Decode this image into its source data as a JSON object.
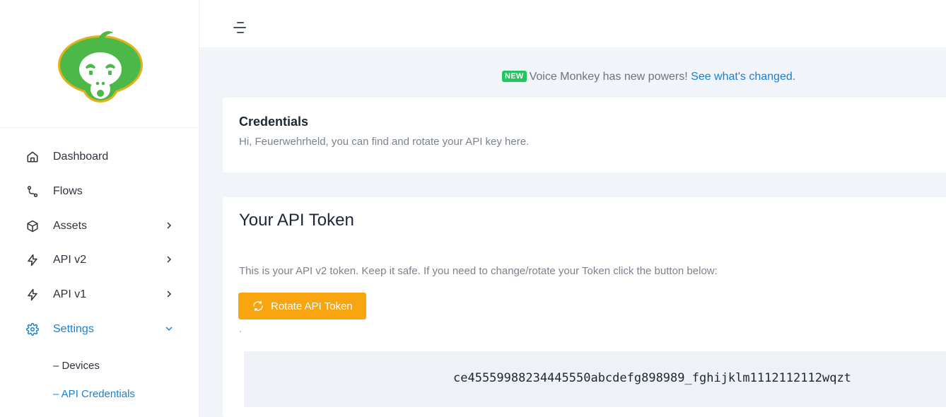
{
  "sidebar": {
    "items": [
      {
        "label": "Dashboard",
        "icon": "home-icon"
      },
      {
        "label": "Flows",
        "icon": "route-icon"
      },
      {
        "label": "Assets",
        "icon": "box-icon"
      },
      {
        "label": "API v2",
        "icon": "bolt-icon"
      },
      {
        "label": "API v1",
        "icon": "bolt-icon"
      },
      {
        "label": "Settings",
        "icon": "gear-icon"
      }
    ],
    "sub_items": [
      {
        "label": "– Devices"
      },
      {
        "label": "– API Credentials"
      }
    ]
  },
  "notice": {
    "badge": "NEW",
    "text": "Voice Monkey has new powers! ",
    "link": "See what's changed",
    "suffix": "."
  },
  "credentials": {
    "title": "Credentials",
    "subtitle": "Hi, Feuerwehrheld, you can find and rotate your API key here."
  },
  "token_card": {
    "title": "Your API Token",
    "description": "This is your API v2 token. Keep it safe. If you need to change/rotate your Token click the button below:",
    "button_label": "Rotate API Token",
    "dot": ".",
    "token": "ce45559988234445550abcdefg898989_fghijklm1112112112wqzt"
  },
  "colors": {
    "accent": "#1b7fd1",
    "button": "#f8a50f",
    "badge": "#22c55e",
    "logo": "#4cb847"
  }
}
